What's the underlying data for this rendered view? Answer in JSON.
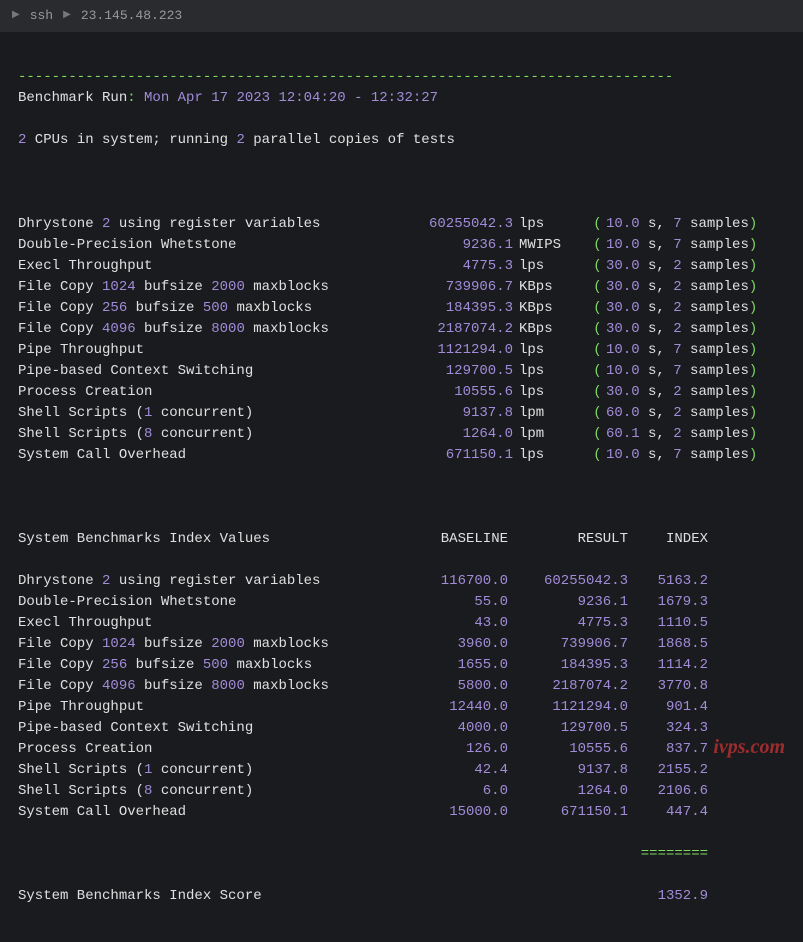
{
  "titlebar": {
    "ssh_label": "ssh",
    "ip": "23.145.48.223"
  },
  "header": {
    "run_label": "Benchmark Run",
    "run_time": "Mon Apr 17 2023 12:04:20 - 12:32:27",
    "cpu_count": "2",
    "cpu_line_a": " CPUs in system; running ",
    "parallel_count": "2",
    "cpu_line_b": " parallel copies of tests"
  },
  "tests": [
    {
      "name_pre": "Dhrystone ",
      "p1": "2",
      "name_mid": " using register variables",
      "p2": "",
      "name_post": "",
      "score": "60255042.3",
      "unit": "lps",
      "time": "10.0",
      "samples": "7"
    },
    {
      "name_pre": "Double-Precision Whetstone",
      "p1": "",
      "name_mid": "",
      "p2": "",
      "name_post": "",
      "score": "9236.1",
      "unit": "MWIPS",
      "time": "10.0",
      "samples": "7"
    },
    {
      "name_pre": "Execl Throughput",
      "p1": "",
      "name_mid": "",
      "p2": "",
      "name_post": "",
      "score": "4775.3",
      "unit": "lps",
      "time": "30.0",
      "samples": "2"
    },
    {
      "name_pre": "File Copy ",
      "p1": "1024",
      "name_mid": " bufsize ",
      "p2": "2000",
      "name_post": " maxblocks",
      "score": "739906.7",
      "unit": "KBps",
      "time": "30.0",
      "samples": "2"
    },
    {
      "name_pre": "File Copy ",
      "p1": "256",
      "name_mid": " bufsize ",
      "p2": "500",
      "name_post": " maxblocks",
      "score": "184395.3",
      "unit": "KBps",
      "time": "30.0",
      "samples": "2"
    },
    {
      "name_pre": "File Copy ",
      "p1": "4096",
      "name_mid": " bufsize ",
      "p2": "8000",
      "name_post": " maxblocks",
      "score": "2187074.2",
      "unit": "KBps",
      "time": "30.0",
      "samples": "2"
    },
    {
      "name_pre": "Pipe Throughput",
      "p1": "",
      "name_mid": "",
      "p2": "",
      "name_post": "",
      "score": "1121294.0",
      "unit": "lps",
      "time": "10.0",
      "samples": "7"
    },
    {
      "name_pre": "Pipe-based Context Switching",
      "p1": "",
      "name_mid": "",
      "p2": "",
      "name_post": "",
      "score": "129700.5",
      "unit": "lps",
      "time": "10.0",
      "samples": "7"
    },
    {
      "name_pre": "Process Creation",
      "p1": "",
      "name_mid": "",
      "p2": "",
      "name_post": "",
      "score": "10555.6",
      "unit": "lps",
      "time": "30.0",
      "samples": "2"
    },
    {
      "name_pre": "Shell Scripts (",
      "p1": "1",
      "name_mid": " concurrent)",
      "p2": "",
      "name_post": "",
      "score": "9137.8",
      "unit": "lpm",
      "time": "60.0",
      "samples": "2"
    },
    {
      "name_pre": "Shell Scripts (",
      "p1": "8",
      "name_mid": " concurrent)",
      "p2": "",
      "name_post": "",
      "score": "1264.0",
      "unit": "lpm",
      "time": "60.1",
      "samples": "2"
    },
    {
      "name_pre": "System Call Overhead",
      "p1": "",
      "name_mid": "",
      "p2": "",
      "name_post": "",
      "score": "671150.1",
      "unit": "lps",
      "time": "10.0",
      "samples": "7"
    }
  ],
  "index_header": {
    "title": "System Benchmarks Index Values",
    "baseline": "BASELINE",
    "result": "RESULT",
    "index": "INDEX"
  },
  "index": [
    {
      "name_pre": "Dhrystone ",
      "p1": "2",
      "name_mid": " using register variables",
      "p2": "",
      "name_post": "",
      "baseline": "116700.0",
      "result": "60255042.3",
      "index": "5163.2"
    },
    {
      "name_pre": "Double-Precision Whetstone",
      "p1": "",
      "name_mid": "",
      "p2": "",
      "name_post": "",
      "baseline": "55.0",
      "result": "9236.1",
      "index": "1679.3"
    },
    {
      "name_pre": "Execl Throughput",
      "p1": "",
      "name_mid": "",
      "p2": "",
      "name_post": "",
      "baseline": "43.0",
      "result": "4775.3",
      "index": "1110.5"
    },
    {
      "name_pre": "File Copy ",
      "p1": "1024",
      "name_mid": " bufsize ",
      "p2": "2000",
      "name_post": " maxblocks",
      "baseline": "3960.0",
      "result": "739906.7",
      "index": "1868.5"
    },
    {
      "name_pre": "File Copy ",
      "p1": "256",
      "name_mid": " bufsize ",
      "p2": "500",
      "name_post": " maxblocks",
      "baseline": "1655.0",
      "result": "184395.3",
      "index": "1114.2"
    },
    {
      "name_pre": "File Copy ",
      "p1": "4096",
      "name_mid": " bufsize ",
      "p2": "8000",
      "name_post": " maxblocks",
      "baseline": "5800.0",
      "result": "2187074.2",
      "index": "3770.8"
    },
    {
      "name_pre": "Pipe Throughput",
      "p1": "",
      "name_mid": "",
      "p2": "",
      "name_post": "",
      "baseline": "12440.0",
      "result": "1121294.0",
      "index": "901.4"
    },
    {
      "name_pre": "Pipe-based Context Switching",
      "p1": "",
      "name_mid": "",
      "p2": "",
      "name_post": "",
      "baseline": "4000.0",
      "result": "129700.5",
      "index": "324.3"
    },
    {
      "name_pre": "Process Creation",
      "p1": "",
      "name_mid": "",
      "p2": "",
      "name_post": "",
      "baseline": "126.0",
      "result": "10555.6",
      "index": "837.7"
    },
    {
      "name_pre": "Shell Scripts (",
      "p1": "1",
      "name_mid": " concurrent)",
      "p2": "",
      "name_post": "",
      "baseline": "42.4",
      "result": "9137.8",
      "index": "2155.2"
    },
    {
      "name_pre": "Shell Scripts (",
      "p1": "8",
      "name_mid": " concurrent)",
      "p2": "",
      "name_post": "",
      "baseline": "6.0",
      "result": "1264.0",
      "index": "2106.6"
    },
    {
      "name_pre": "System Call Overhead",
      "p1": "",
      "name_mid": "",
      "p2": "",
      "name_post": "",
      "baseline": "15000.0",
      "result": "671150.1",
      "index": "447.4"
    }
  ],
  "footer": {
    "label": "System Benchmarks Index Score",
    "score": "1352.9"
  },
  "misc": {
    "s_label": " s, ",
    "samples_label": " samples",
    "colon": ": ",
    "lparen": "(",
    "rparen": ")",
    "hr": "------------------------------------------------------------------------------",
    "idx_underline": "========",
    "watermark": "ivps.com"
  }
}
